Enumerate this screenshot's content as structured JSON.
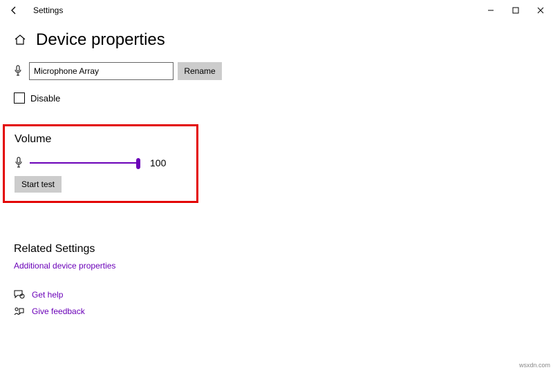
{
  "titlebar": {
    "app_title": "Settings"
  },
  "page": {
    "heading": "Device properties"
  },
  "device": {
    "name_value": "Microphone Array",
    "rename_label": "Rename"
  },
  "disable": {
    "label": "Disable",
    "checked": false
  },
  "volume": {
    "heading": "Volume",
    "value": "100",
    "start_test_label": "Start test"
  },
  "related": {
    "heading": "Related Settings",
    "link_additional": "Additional device properties"
  },
  "help": {
    "get_help": "Get help",
    "give_feedback": "Give feedback"
  },
  "watermark": "wsxdn.com",
  "colors": {
    "accent": "#6a00b8",
    "highlight_border": "#e30000",
    "button_bg": "#cccccc"
  }
}
